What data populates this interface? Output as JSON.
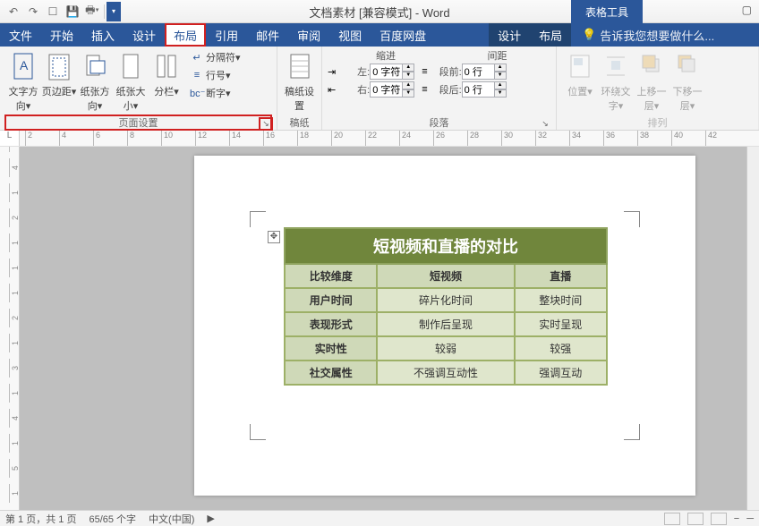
{
  "title": "文档素材 [兼容模式] - Word",
  "table_tools_label": "表格工具",
  "qat": [
    "undo",
    "redo",
    "touch",
    "save",
    "print",
    "customize"
  ],
  "tabs": {
    "main": [
      "文件",
      "开始",
      "插入",
      "设计",
      "布局",
      "引用",
      "邮件",
      "审阅",
      "视图",
      "百度网盘"
    ],
    "active": "布局",
    "context": [
      "设计",
      "布局"
    ],
    "tell_me": "告诉我您想要做什么..."
  },
  "ribbon": {
    "page_setup": {
      "label": "页面设置",
      "items": {
        "text_dir": "文字方向",
        "margins": "页边距",
        "orientation": "纸张方向",
        "size": "纸张大小",
        "columns": "分栏",
        "breaks": "分隔符",
        "line_num": "行号",
        "hyphen": "断字"
      }
    },
    "paper": {
      "label": "稿纸",
      "item": "稿纸设置"
    },
    "paragraph": {
      "label": "段落",
      "indent_label": "缩进",
      "spacing_label": "间距",
      "left": "左:",
      "right": "右:",
      "before": "段前:",
      "after": "段后:",
      "val_left": "0 字符",
      "val_right": "0 字符",
      "val_before": "0 行",
      "val_after": "0 行"
    },
    "arrange": {
      "label": "排列",
      "pos": "位置",
      "wrap": "环绕文字",
      "fwd": "上移一层",
      "back": "下移一层"
    }
  },
  "ruler_h": [
    2,
    4,
    6,
    8,
    10,
    12,
    14,
    16,
    18,
    20,
    22,
    24,
    26,
    28,
    30,
    32,
    34,
    36,
    38,
    40,
    42
  ],
  "ruler_v": [
    "1",
    "4",
    "1",
    "2",
    "1",
    "1",
    "1",
    "2",
    "1",
    "3",
    "1",
    "4",
    "1",
    "5",
    "1"
  ],
  "doc_table": {
    "title": "短视频和直播的对比",
    "cols": [
      "比较维度",
      "短视频",
      "直播"
    ],
    "rows": [
      [
        "用户时间",
        "碎片化时间",
        "整块时间"
      ],
      [
        "表现形式",
        "制作后呈现",
        "实时呈现"
      ],
      [
        "实时性",
        "较弱",
        "较强"
      ],
      [
        "社交属性",
        "不强调互动性",
        "强调互动"
      ]
    ]
  },
  "status": {
    "page": "第 1 页，共 1 页",
    "words": "65/65 个字",
    "lang": "中文(中国)"
  },
  "icons": {
    "undo": "↶",
    "redo": "↷",
    "save": "💾",
    "shield": "▲",
    "bulb": "💡"
  }
}
